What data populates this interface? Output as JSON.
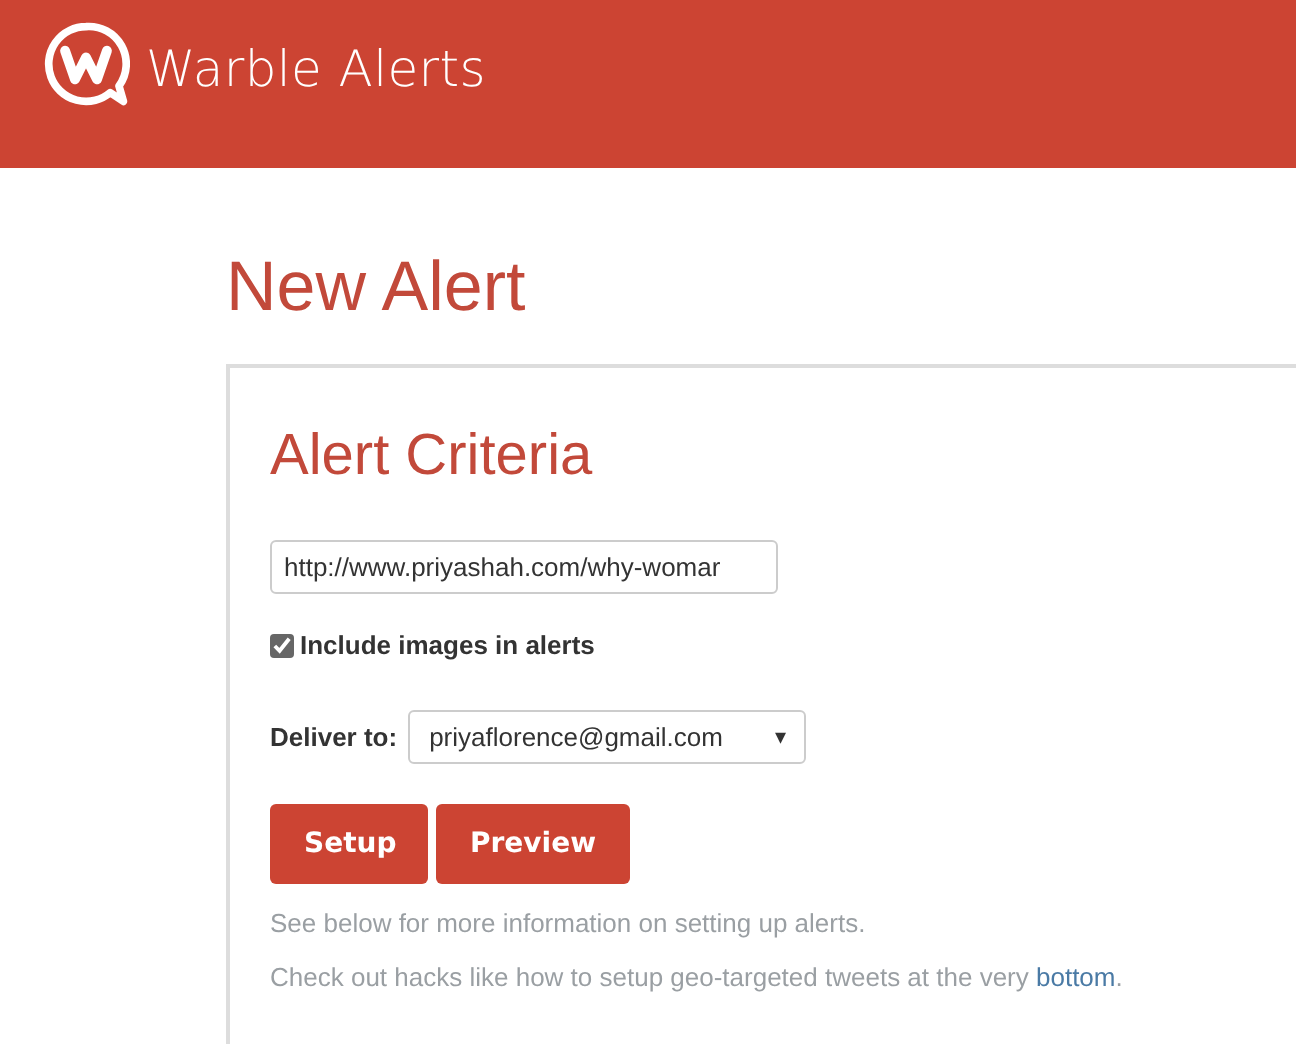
{
  "header": {
    "brand": "Warble Alerts"
  },
  "page": {
    "title": "New Alert"
  },
  "card": {
    "title": "Alert Criteria",
    "url_field": {
      "value": "http://www.priyashah.com/why-womar"
    },
    "include_images": {
      "label": "Include images in alerts",
      "checked": true
    },
    "deliver": {
      "label": "Deliver to:",
      "value": "priyaflorence@gmail.com",
      "caret": "▾"
    },
    "buttons": [
      "Setup",
      "Preview"
    ],
    "note": "See below for more information on setting up alerts.",
    "hack_note": {
      "text": "Check out hacks like how to setup geo-targeted tweets at the very ",
      "link": "bottom",
      "end": "."
    }
  }
}
